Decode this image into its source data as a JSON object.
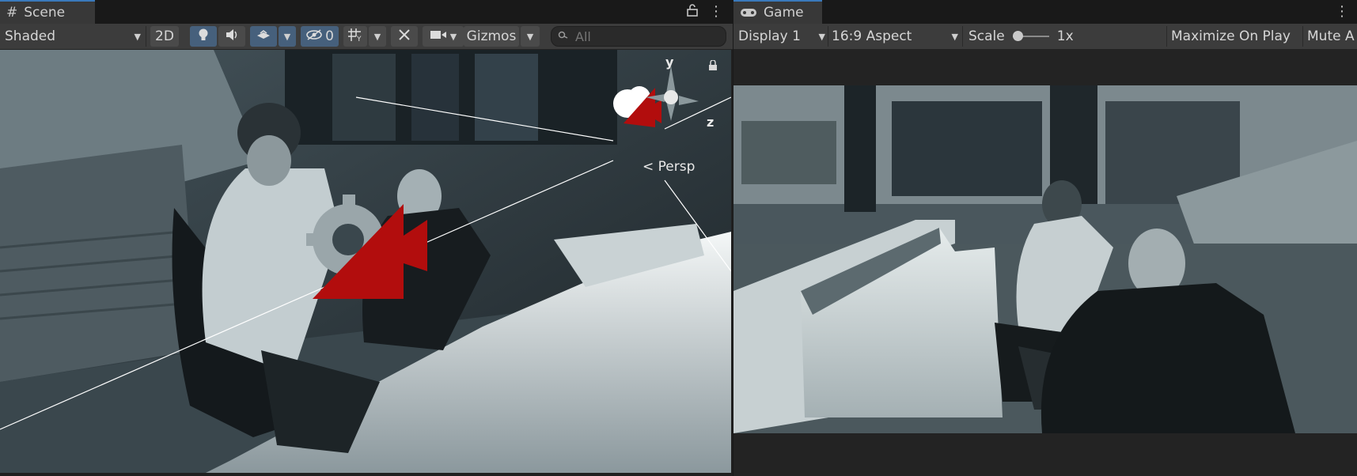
{
  "scene": {
    "tab_label": "Scene",
    "toolbar": {
      "draw_mode": "Shaded",
      "mode_2d": "2D",
      "hidden_count": "0",
      "gizmos": "Gizmos",
      "search_placeholder": "All"
    },
    "view": {
      "projection_label": "< Persp",
      "axis_y": "y",
      "axis_z": "z"
    }
  },
  "game": {
    "tab_label": "Game",
    "toolbar": {
      "display": "Display 1",
      "aspect": "16:9 Aspect",
      "scale_label": "Scale",
      "scale_value": "1x",
      "maximize": "Maximize On Play",
      "mute": "Mute A"
    }
  },
  "colors": {
    "accent": "#3a79bb",
    "gizmo_red": "#b20d0d",
    "toolbar_bg": "#3c3c3c",
    "tab_bg": "#383838"
  }
}
